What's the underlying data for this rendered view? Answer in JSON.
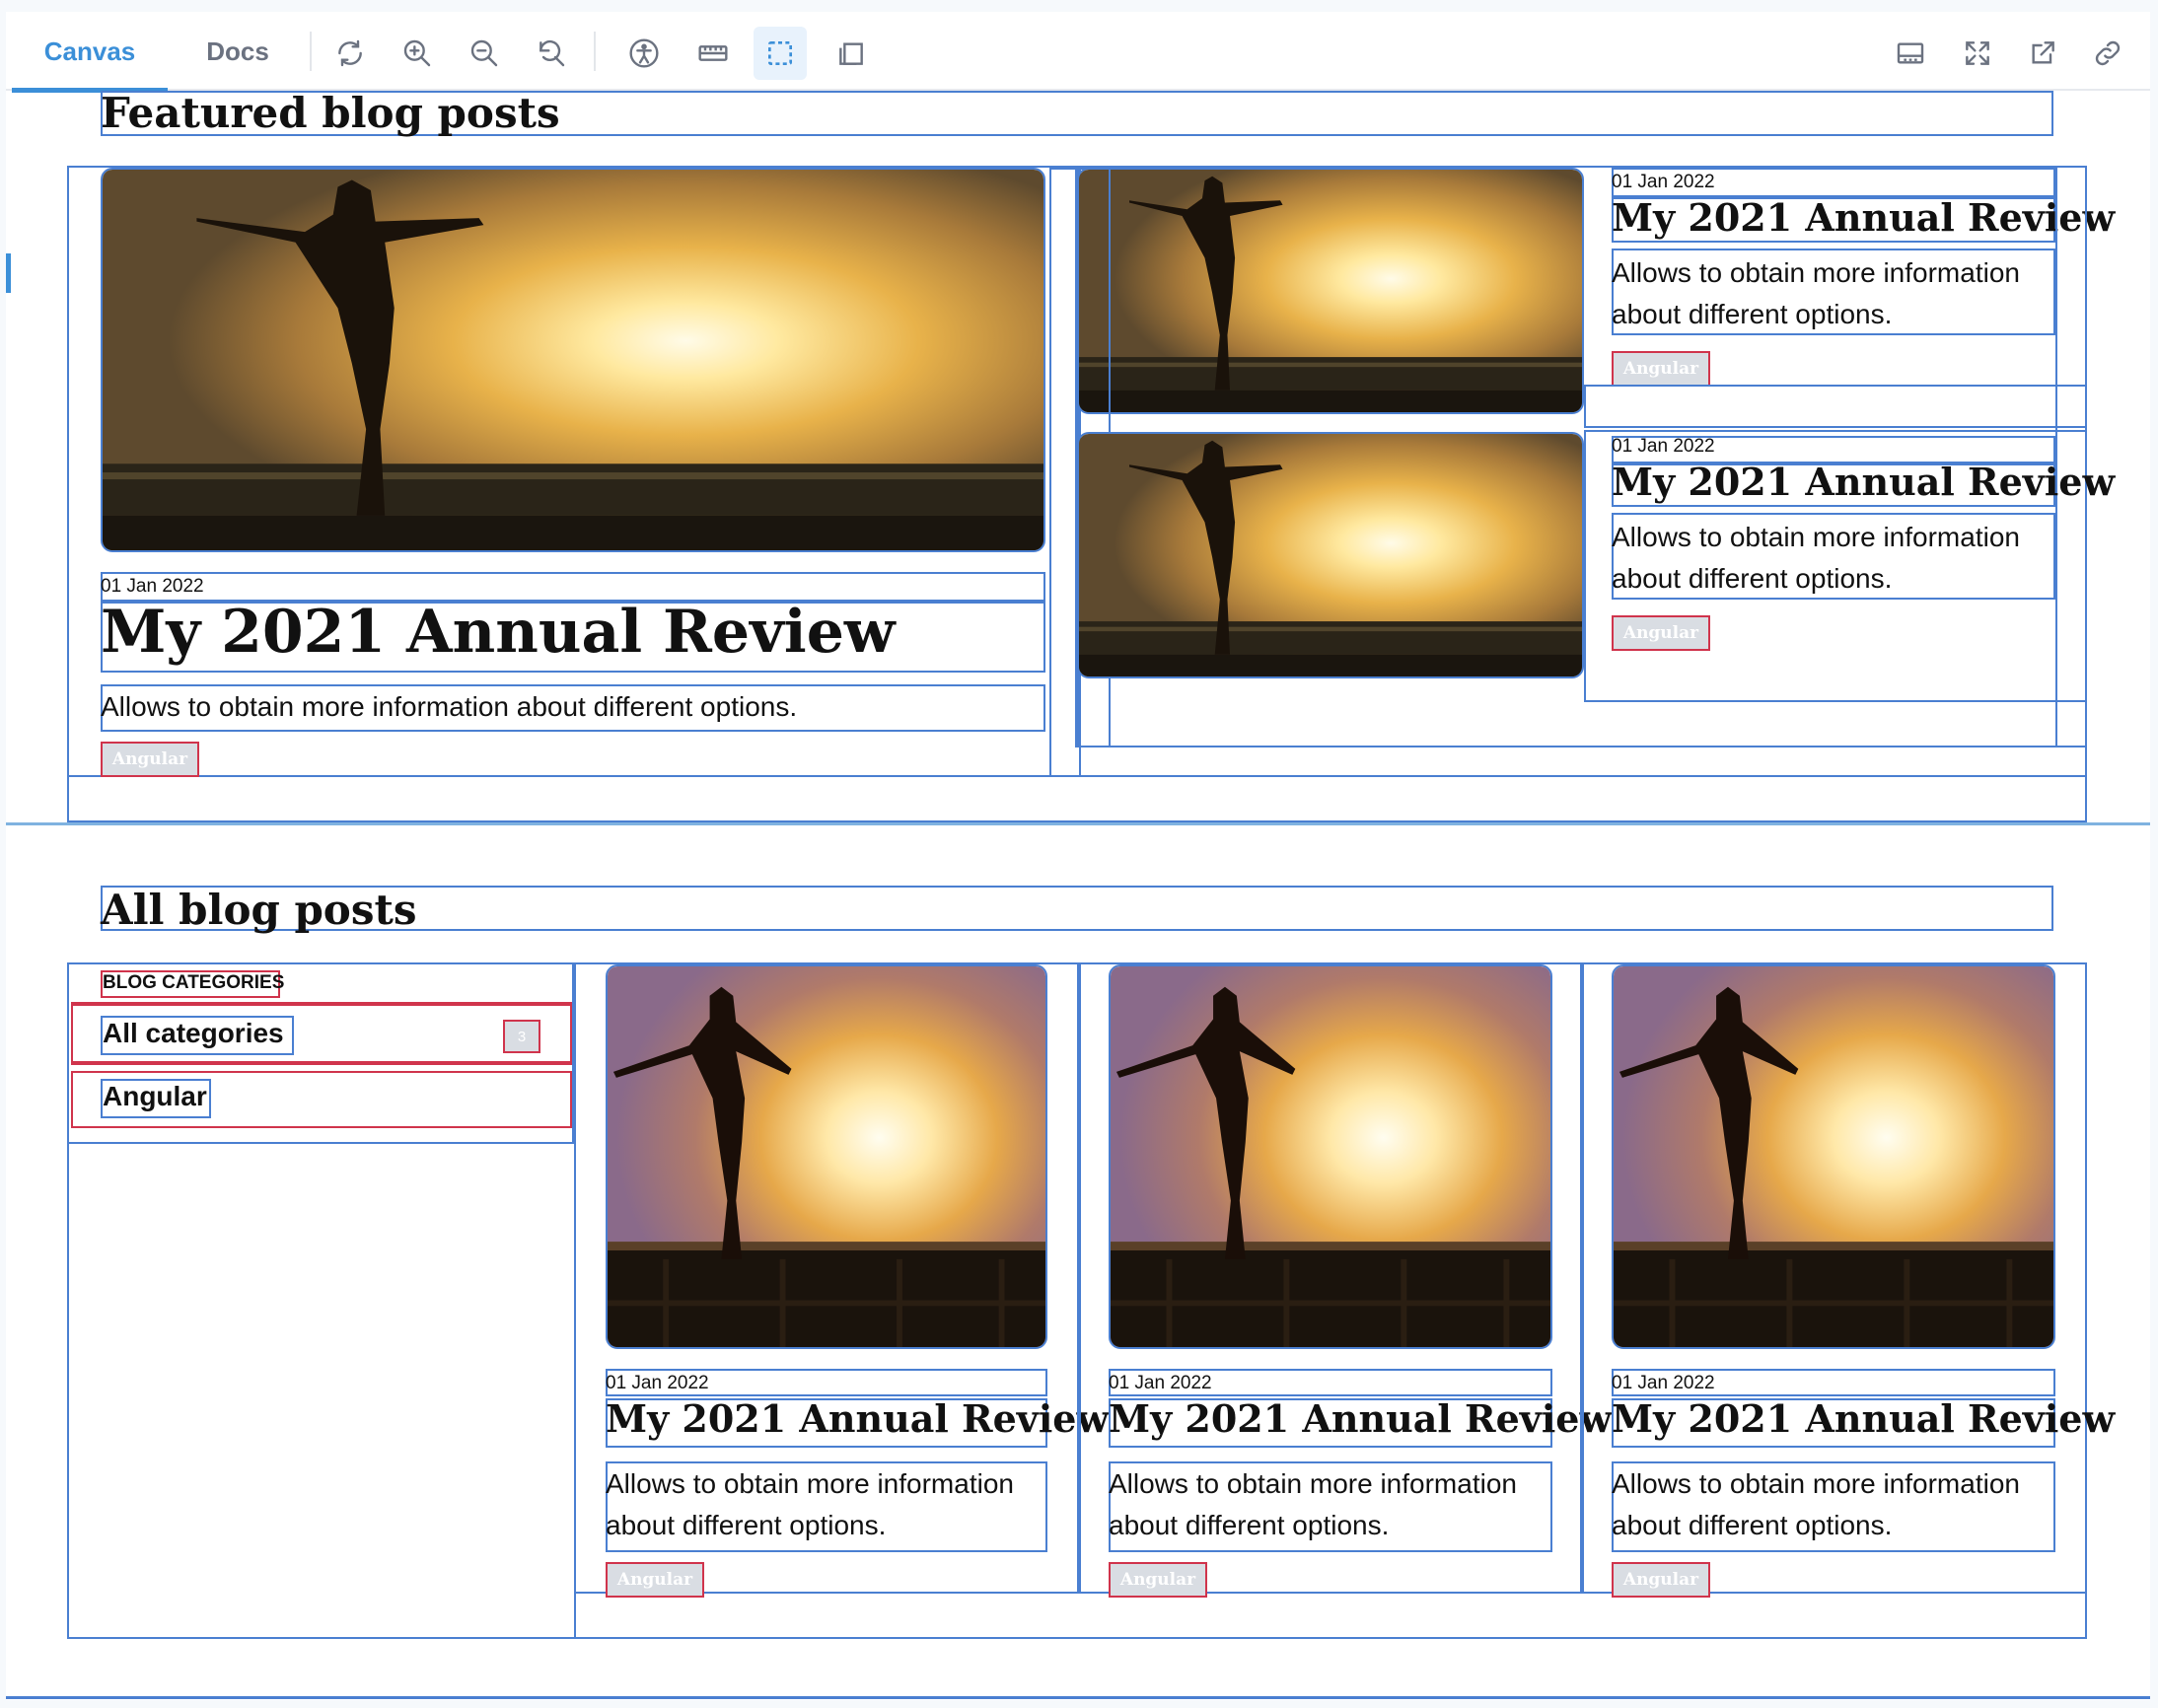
{
  "toolbar": {
    "tabs": [
      {
        "label": "Canvas",
        "active": true
      },
      {
        "label": "Docs",
        "active": false
      }
    ],
    "left_icons": [
      "reload-icon",
      "zoom-in-icon",
      "zoom-out-icon",
      "reset-zoom-icon",
      "accessibility-icon",
      "ruler-icon",
      "outline-icon",
      "measure-icon"
    ],
    "right_icons": [
      "addons-panel-icon",
      "fullscreen-icon",
      "open-new-tab-icon",
      "copy-link-icon"
    ],
    "accent": "#3b8fd8"
  },
  "featured": {
    "heading": "Featured blog posts",
    "main": {
      "date": "01 Jan 2022",
      "title": "My 2021 Annual Review",
      "description": "Allows to obtain more information about different options.",
      "tag": "Angular"
    },
    "side": [
      {
        "date": "01 Jan 2022",
        "title": "My 2021 Annual Review",
        "description": "Allows to obtain more information about different options.",
        "tag": "Angular"
      },
      {
        "date": "01 Jan 2022",
        "title": "My 2021 Annual Review",
        "description": "Allows to obtain more information about different options.",
        "tag": "Angular"
      }
    ]
  },
  "all": {
    "heading": "All blog posts",
    "categories_label": "BLOG CATEGORIES",
    "categories": [
      {
        "label": "All categories",
        "count": "3"
      },
      {
        "label": "Angular"
      }
    ],
    "posts": [
      {
        "date": "01 Jan 2022",
        "title": "My 2021 Annual Review",
        "description": "Allows to obtain more information about different options.",
        "tag": "Angular"
      },
      {
        "date": "01 Jan 2022",
        "title": "My 2021 Annual Review",
        "description": "Allows to obtain more information about different options.",
        "tag": "Angular"
      },
      {
        "date": "01 Jan 2022",
        "title": "My 2021 Annual Review",
        "description": "Allows to obtain more information about different options.",
        "tag": "Angular"
      }
    ]
  },
  "colors": {
    "outline": "#4a7fd1",
    "tag_border": "#d0344c",
    "divider": "#7fb2e0"
  }
}
